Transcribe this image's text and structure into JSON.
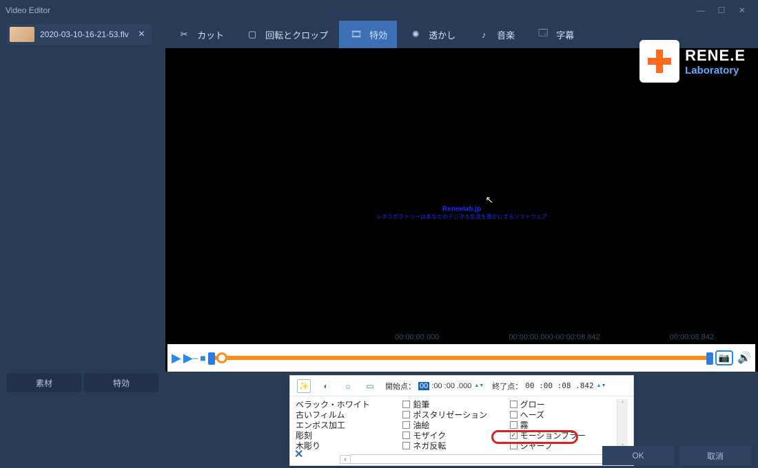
{
  "window": {
    "title": "Video Editor"
  },
  "file": {
    "name": "2020-03-10-16-21-53.flv"
  },
  "tabs": {
    "cut": "カット",
    "rotate": "回転とクロップ",
    "fx": "特効",
    "watermark": "透かし",
    "audio": "音楽",
    "subtitle": "字幕"
  },
  "brand": {
    "line1": "RENE.E",
    "line2": "Laboratory"
  },
  "preview": {
    "wm_title": "Reneelab.jp",
    "wm_sub": "レネラボラトリーはあなたのデジタル生活を豊かにするソフトウェア"
  },
  "lefttabs": {
    "material": "素材",
    "fx": "特効"
  },
  "timeline": {
    "start": "00:00:00.000",
    "range": "00:00:00.000-00:00:08.842",
    "end": "00:00:08.842"
  },
  "fxpanel": {
    "start_label": "開始点：",
    "end_label": "終了点：",
    "start_hl": "00",
    "start_rest": " :00 :00 .000",
    "end_val": "00 :00 :08 .842",
    "col1": [
      "ベラック・ホワイト",
      "古いフィルム",
      "エンボス加工",
      "彫刻",
      "木彫り"
    ],
    "col2": [
      "鉛筆",
      "ポスタリゼーション",
      "油絵",
      "モザイク",
      "ネガ反転"
    ],
    "col3": [
      "グロー",
      "ヘーズ",
      "霧",
      "モーションブラー",
      "シャープ"
    ],
    "checked": "モーションブラー"
  },
  "buttons": {
    "ok": "OK",
    "cancel": "取消"
  }
}
